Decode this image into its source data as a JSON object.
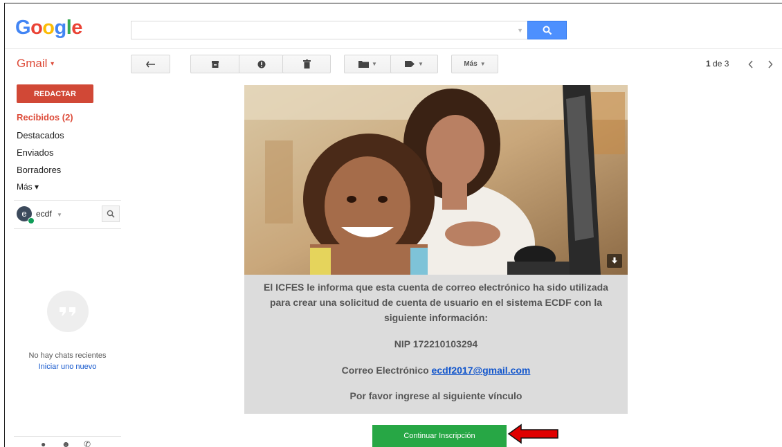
{
  "header": {
    "logo": {
      "G": "G",
      "o1": "o",
      "o2": "o",
      "g": "g",
      "l": "l",
      "e": "e"
    },
    "search": {
      "value": "",
      "placeholder": ""
    }
  },
  "app": {
    "label": "Gmail",
    "caret": "▾"
  },
  "toolbar": {
    "more_label": "Más",
    "pager_current": "1",
    "pager_of": "de 3",
    "icons": [
      "reply-icon",
      "archive-icon",
      "spam-icon",
      "delete-icon",
      "folder-icon",
      "label-icon"
    ]
  },
  "sidebar": {
    "compose_label": "REDACTAR",
    "items": [
      {
        "label": "Recibidos (2)",
        "active": true
      },
      {
        "label": "Destacados"
      },
      {
        "label": "Enviados"
      },
      {
        "label": "Borradores"
      },
      {
        "label": "Más ▾"
      }
    ],
    "user": {
      "initial": "e",
      "name": "ecdf",
      "status_color": "#0f9d58"
    },
    "chat": {
      "empty_text": "No hay chats recientes",
      "start_link": "Iniciar uno nuevo"
    }
  },
  "email": {
    "body_line1": "El ICFES le informa que esta cuenta de correo electrónico ha sido utilizada",
    "body_line2": "para crear una solicitud de cuenta de usuario en el sistema ECDF con la",
    "body_line3": "siguiente información:",
    "nip_label": "NIP 172210103294",
    "email_label": "Correo Electrónico",
    "email_value": "ecdf2017@gmail.com",
    "instruction": "Por favor ingrese al siguiente vínculo",
    "button_label": "Continuar Inscripción"
  },
  "colors": {
    "accent_red": "#dd4b39",
    "compose_red": "#d14836",
    "search_blue": "#4d90fe",
    "link_blue": "#1155cc",
    "button_green": "#27a745",
    "annotation_arrow": "#e00000"
  }
}
